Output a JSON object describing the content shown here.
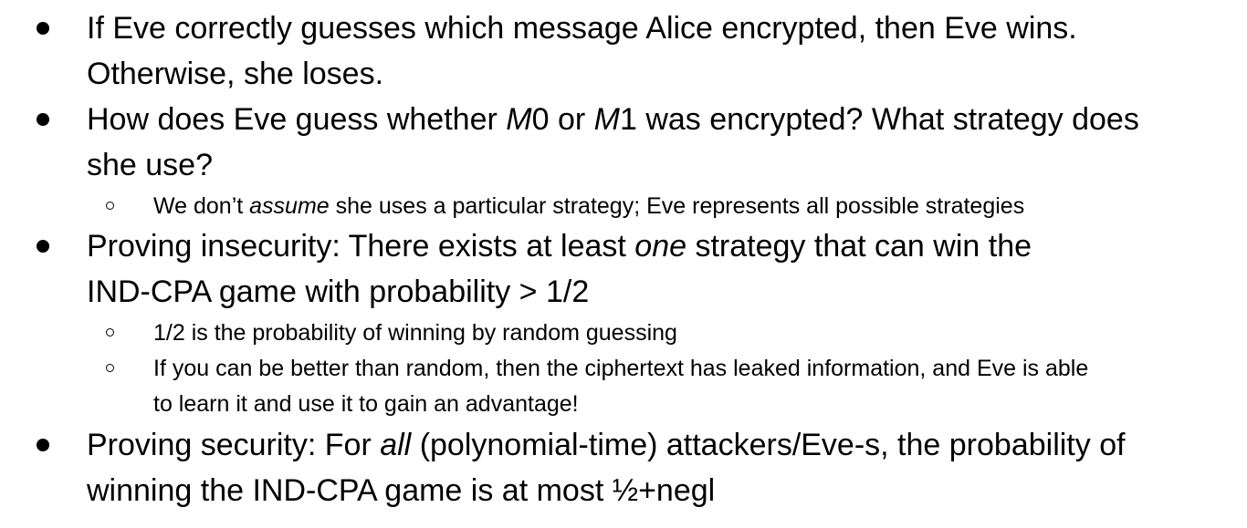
{
  "bullets": [
    {
      "line1": "If Eve correctly guesses which message Alice encrypted, then Eve wins.",
      "line2": "Otherwise, she loses."
    },
    {
      "line1_a": "How does Eve guess whether ",
      "m0_letter": "M",
      "m0_sub": "0",
      "line1_b": " or ",
      "m1_letter": "M",
      "m1_sub": "1",
      "line1_c": " was encrypted? What strategy does",
      "line2": "she use?",
      "sub": [
        {
          "text_a": "We don’t ",
          "text_em": "assume",
          "text_b": " she uses a particular strategy; Eve represents all possible strategies"
        }
      ]
    },
    {
      "line1_a": "Proving insecurity: There exists at least ",
      "line1_em": "one",
      "line1_b": " strategy that can win the",
      "line2": "IND-CPA game with probability > 1/2",
      "sub": [
        {
          "text": "1/2 is the probability of winning by random guessing"
        },
        {
          "line1": "If you can be better than random, then the ciphertext has leaked information, and Eve is able",
          "line2": "to learn it and use it to gain an advantage!"
        }
      ]
    },
    {
      "line1_a": "Proving security: For ",
      "line1_em": "all",
      "line1_b": " (polynomial-time) attackers/Eve-s, the probability of",
      "line2": "winning the IND-CPA game is at most ½+negl"
    }
  ]
}
